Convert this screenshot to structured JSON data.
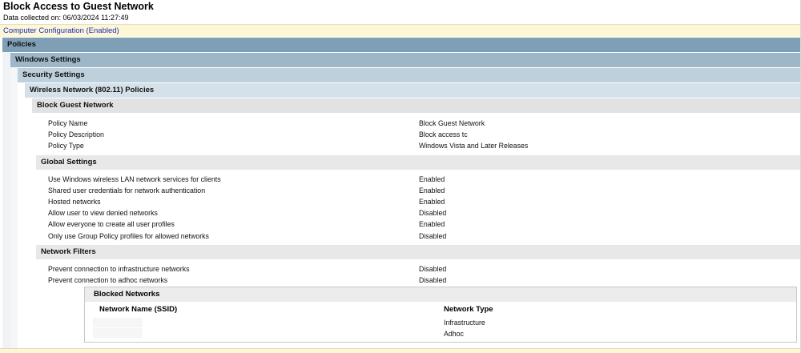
{
  "report": {
    "title": "Block Access to Guest Network",
    "collected": "Data collected on: 06/03/2024 11:27:49",
    "section": "Computer Configuration (Enabled)"
  },
  "tree": {
    "policies": "Policies",
    "windows_settings": "Windows Settings",
    "security_settings": "Security Settings",
    "wireless": "Wireless Network (802.11) Policies",
    "block_guest": "Block Guest Network"
  },
  "policy": {
    "rows": [
      {
        "label": "Policy Name",
        "value": "Block Guest Network"
      },
      {
        "label": "Policy Description",
        "value": "Block access tc"
      },
      {
        "label": "Policy Type",
        "value": "Windows Vista and Later Releases"
      }
    ]
  },
  "global": {
    "header": "Global Settings",
    "rows": [
      {
        "label": "Use Windows wireless LAN network services for clients",
        "value": "Enabled"
      },
      {
        "label": "Shared user credentials for network authentication",
        "value": "Enabled"
      },
      {
        "label": "Hosted networks",
        "value": "Enabled"
      },
      {
        "label": "Allow user to view denied networks",
        "value": "Disabled"
      },
      {
        "label": "Allow everyone to create all user profiles",
        "value": "Enabled"
      },
      {
        "label": "Only use Group Policy profiles for allowed networks",
        "value": "Disabled"
      }
    ]
  },
  "filters": {
    "header": "Network Filters",
    "rows": [
      {
        "label": "Prevent connection to infrastructure networks",
        "value": "Disabled"
      },
      {
        "label": "Prevent connection to adhoc networks",
        "value": "Disabled"
      }
    ],
    "blocked": {
      "header": "Blocked Networks",
      "col_name": "Network Name (SSID)",
      "col_type": "Network Type",
      "rows": [
        {
          "type": "Infrastructure"
        },
        {
          "type": "Adhoc"
        }
      ]
    }
  }
}
